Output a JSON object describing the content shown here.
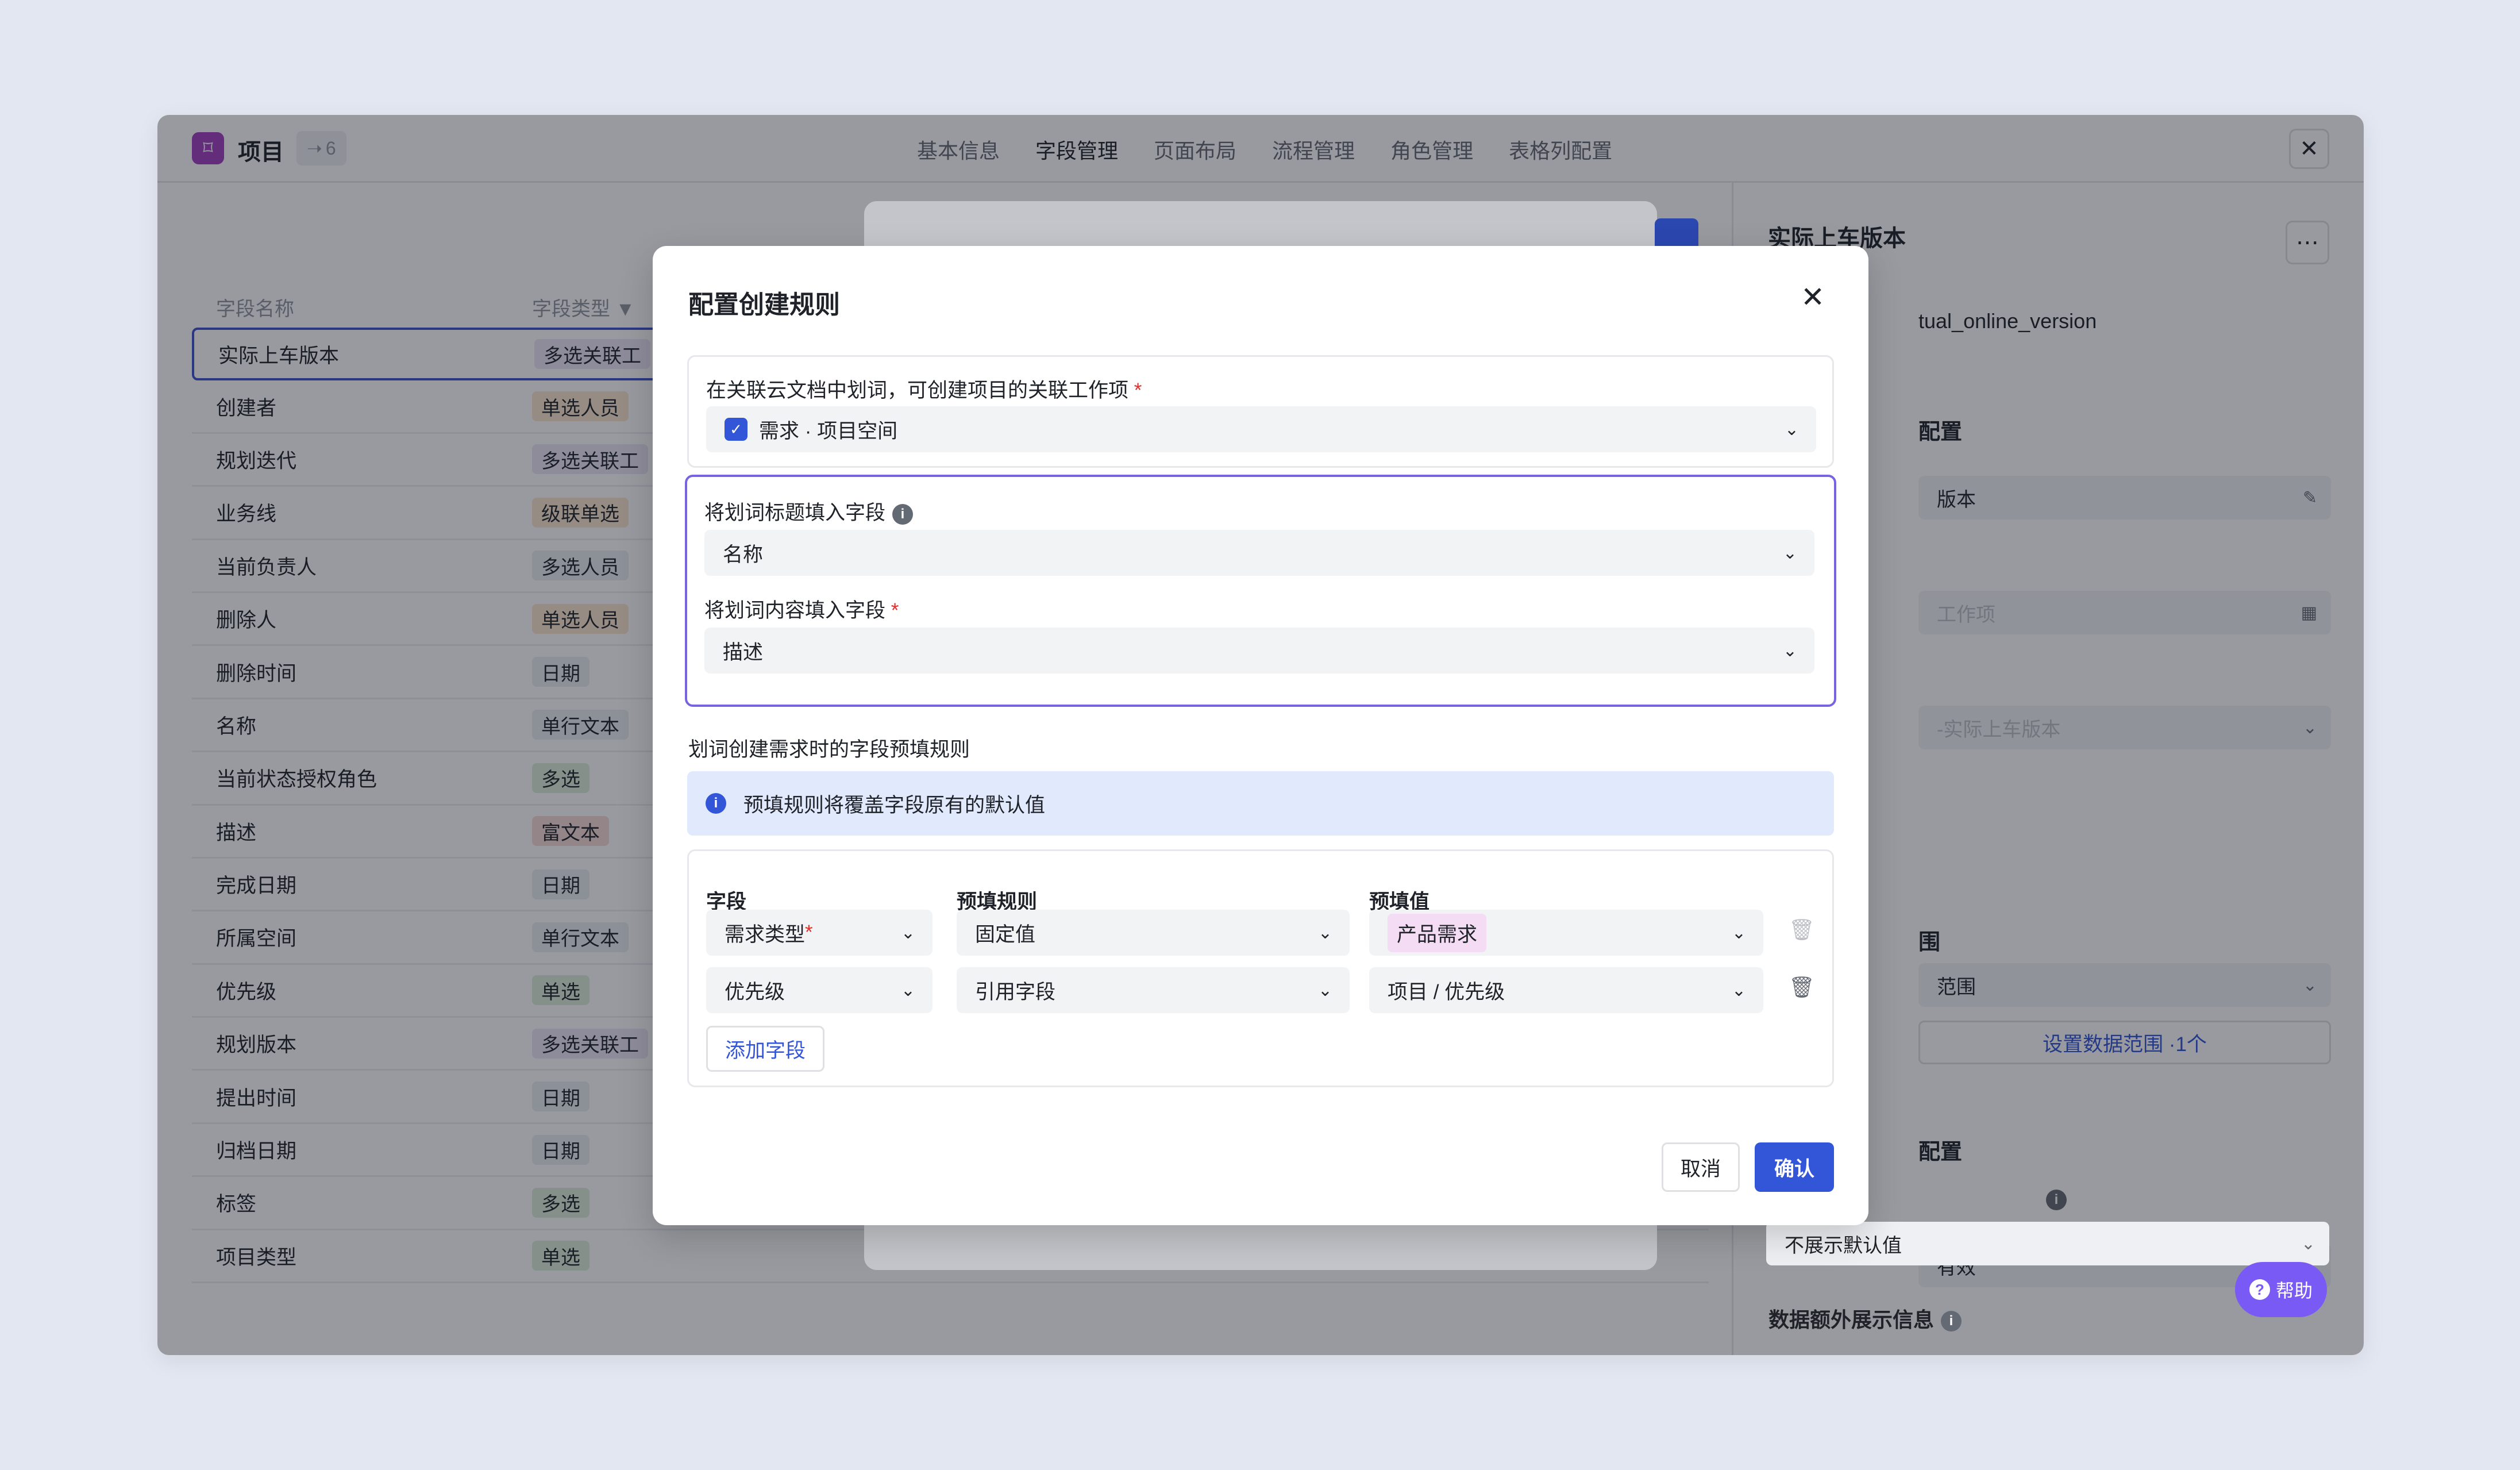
{
  "header": {
    "project_title": "项目",
    "project_count": "6",
    "tabs": [
      "基本信息",
      "字段管理",
      "页面布局",
      "流程管理",
      "角色管理",
      "表格列配置"
    ],
    "active_tab": "字段管理"
  },
  "table": {
    "col_name": "字段名称",
    "col_type": "字段类型",
    "rows": [
      {
        "name": "实际上车版本",
        "type": "多选关联工",
        "tone": "purple"
      },
      {
        "name": "创建者",
        "type": "单选人员",
        "tone": "orange"
      },
      {
        "name": "规划迭代",
        "type": "多选关联工",
        "tone": "purple"
      },
      {
        "name": "业务线",
        "type": "级联单选",
        "tone": "orange"
      },
      {
        "name": "当前负责人",
        "type": "多选人员",
        "tone": "gray"
      },
      {
        "name": "删除人",
        "type": "单选人员",
        "tone": "orange"
      },
      {
        "name": "删除时间",
        "type": "日期",
        "tone": "gray"
      },
      {
        "name": "名称",
        "type": "单行文本",
        "tone": "gray"
      },
      {
        "name": "当前状态授权角色",
        "type": "多选",
        "tone": "green"
      },
      {
        "name": "描述",
        "type": "富文本",
        "tone": "red"
      },
      {
        "name": "完成日期",
        "type": "日期",
        "tone": "gray"
      },
      {
        "name": "所属空间",
        "type": "单行文本",
        "tone": "gray"
      },
      {
        "name": "优先级",
        "type": "单选",
        "tone": "green"
      },
      {
        "name": "规划版本",
        "type": "多选关联工",
        "tone": "purple"
      },
      {
        "name": "提出时间",
        "type": "日期",
        "tone": "gray"
      },
      {
        "name": "归档日期",
        "type": "日期",
        "tone": "gray"
      },
      {
        "name": "标签",
        "type": "多选",
        "tone": "green"
      },
      {
        "name": "项目类型",
        "type": "单选",
        "tone": "green"
      }
    ],
    "last_row_extra": {
      "dash": "-",
      "default": "不展示默认值",
      "key": "template"
    }
  },
  "right_panel": {
    "title": "实际上车版本",
    "key_text": "tual_online_version",
    "section1": "配置",
    "field1": "版本",
    "field2": "工作项",
    "field3": "-实际上车版本",
    "section_range": "围",
    "field_range": "范围",
    "range_link": "设置数据范围 ·1个",
    "section2": "配置",
    "field_valid": "有效",
    "field_default": "不展示默认值",
    "extra_info": "数据额外展示信息",
    "help": "帮助"
  },
  "modal": {
    "title": "配置创建规则",
    "source_label": "在关联云文档中划词，可创建项目的关联工作项",
    "source_value": "需求 · 项目空间",
    "title_field_label": "将划词标题填入字段",
    "title_field_value": "名称",
    "content_field_label": "将划词内容填入字段",
    "content_field_value": "描述",
    "prefill_section": "划词创建需求时的字段预填规则",
    "banner": "预填规则将覆盖字段原有的默认值",
    "columns": {
      "field": "字段",
      "rule": "预填规则",
      "value": "预填值"
    },
    "rules": [
      {
        "field": "需求类型",
        "required": true,
        "rule": "固定值",
        "value": "产品需求",
        "value_is_tag": true
      },
      {
        "field": "优先级",
        "required": false,
        "rule": "引用字段",
        "value": "项目 / 优先级",
        "value_is_tag": false
      }
    ],
    "add_field": "添加字段",
    "cancel": "取消",
    "confirm": "确认"
  },
  "icons": {
    "close": "close-icon",
    "chevron": "chevron-down-icon",
    "info": "info-icon",
    "trash": "trash-icon"
  },
  "colors": {
    "accent": "#3355d8",
    "highlight_border": "#7863e0",
    "help": "#7a5af5",
    "project_icon": "#a23fbf"
  }
}
